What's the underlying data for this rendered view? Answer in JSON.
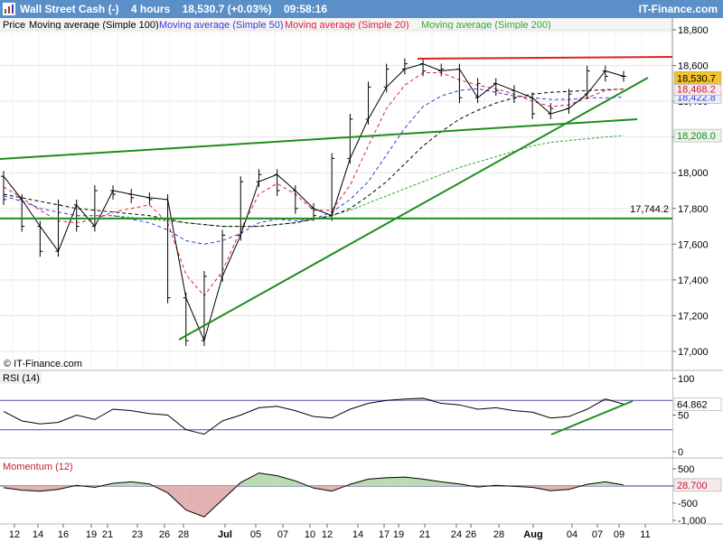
{
  "header": {
    "title": "Wall Street Cash (-)    4 hours    18,530.7 (+0.03%)    09:58:16",
    "brand": "IT-Finance.com"
  },
  "legend": {
    "price": "Price",
    "ma100": "Moving average (Simple 100)",
    "ma50": "Moving average (Simple 50)",
    "ma20": "Moving average (Simple 20)",
    "ma200": "Moving average (Simple 200)"
  },
  "colors": {
    "ma100": "#000000",
    "ma50": "#3a3ad8",
    "ma20": "#e0203c",
    "ma200": "#32a832",
    "trend": "#1e8c1e",
    "resistance": "#e02020",
    "price_tag": "#f2c22c"
  },
  "watermark": "© IT-Finance.com",
  "chart_data": [
    {
      "type": "line",
      "panel": "price",
      "ylim": [
        16900,
        18900
      ],
      "y_ticks": [
        "18,800",
        "18,600",
        "18,400",
        "18,200",
        "18,000",
        "17,800",
        "17,600",
        "17,400",
        "17,200",
        "17,000"
      ],
      "x_ticks": [
        "12",
        "14",
        "16",
        "19",
        "21",
        "23",
        "26",
        "28",
        "Jul",
        "05",
        "07",
        "10",
        "12",
        "14",
        "17",
        "19",
        "21",
        "24",
        "26",
        "28",
        "Aug",
        "04",
        "07",
        "09",
        "11"
      ],
      "series": [
        {
          "name": "Price",
          "values": [
            17980,
            17850,
            17700,
            17560,
            17820,
            17700,
            17900,
            17880,
            17860,
            17850,
            17300,
            17060,
            17420,
            17650,
            17950,
            17990,
            17900,
            17800,
            17760,
            18080,
            18300,
            18480,
            18580,
            18610,
            18570,
            18580,
            18420,
            18500,
            18460,
            18420,
            18330,
            18360,
            18440,
            18570,
            18540
          ]
        },
        {
          "name": "Moving average (Simple 20)",
          "values": [
            17920,
            17860,
            17790,
            17730,
            17720,
            17740,
            17780,
            17800,
            17820,
            17720,
            17430,
            17310,
            17450,
            17680,
            17880,
            17940,
            17880,
            17790,
            17790,
            17930,
            18150,
            18360,
            18490,
            18560,
            18560,
            18520,
            18490,
            18470,
            18440,
            18400,
            18370,
            18380,
            18420,
            18460,
            18470
          ]
        },
        {
          "name": "Moving average (Simple 50)",
          "values": [
            17870,
            17840,
            17800,
            17780,
            17760,
            17760,
            17760,
            17740,
            17720,
            17680,
            17620,
            17600,
            17620,
            17660,
            17720,
            17740,
            17730,
            17740,
            17780,
            17850,
            17950,
            18100,
            18250,
            18370,
            18430,
            18460,
            18470,
            18450,
            18430,
            18420,
            18410,
            18410,
            18420,
            18420,
            18423
          ]
        },
        {
          "name": "Moving average (Simple 100)",
          "values": [
            17880,
            17860,
            17840,
            17820,
            17800,
            17790,
            17780,
            17770,
            17760,
            17740,
            17720,
            17710,
            17700,
            17700,
            17700,
            17710,
            17720,
            17740,
            17760,
            17800,
            17870,
            17950,
            18050,
            18150,
            18230,
            18300,
            18350,
            18390,
            18420,
            18440,
            18450,
            18455,
            18460,
            18465,
            18468
          ]
        },
        {
          "name": "Moving average (Simple 200)",
          "values": [
            null,
            null,
            null,
            null,
            null,
            null,
            17760,
            17750,
            17740,
            17730,
            17720,
            17710,
            17700,
            17700,
            17700,
            17710,
            17720,
            17740,
            17760,
            17790,
            17830,
            17870,
            17910,
            17950,
            17990,
            18030,
            18060,
            18090,
            18120,
            18150,
            18170,
            18180,
            18190,
            18200,
            18208
          ]
        }
      ],
      "labels": {
        "ma200_value": "18,208.0",
        "ma50_value": "18,422.8",
        "ma100_value": "18,468.2",
        "price_value": "18,530.7",
        "support_value": "17,744.2"
      }
    },
    {
      "type": "line",
      "panel": "rsi",
      "title": "RSI (14)",
      "ylim": [
        0,
        100
      ],
      "y_ticks": [
        "100",
        "50",
        "0"
      ],
      "levels": [
        70,
        30
      ],
      "series": [
        {
          "name": "RSI (14)",
          "values": [
            55,
            42,
            38,
            40,
            50,
            44,
            58,
            56,
            52,
            50,
            30,
            24,
            42,
            50,
            60,
            62,
            56,
            48,
            46,
            58,
            66,
            70,
            72,
            73,
            66,
            64,
            58,
            60,
            56,
            54,
            46,
            48,
            58,
            72,
            65
          ]
        }
      ],
      "labels": {
        "value": "64.862"
      }
    },
    {
      "type": "area",
      "panel": "momentum",
      "title": "Momentum (12)",
      "ylim": [
        -1100,
        600
      ],
      "y_ticks": [
        "500",
        "0",
        "-500",
        "-1,000"
      ],
      "series": [
        {
          "name": "Momentum (12)",
          "values": [
            -50,
            -120,
            -150,
            -100,
            20,
            -40,
            80,
            120,
            60,
            -200,
            -700,
            -900,
            -400,
            100,
            380,
            300,
            150,
            -60,
            -150,
            50,
            200,
            240,
            260,
            200,
            120,
            60,
            -30,
            20,
            -10,
            -40,
            -140,
            -100,
            50,
            120,
            28.7
          ]
        }
      ],
      "labels": {
        "value": "28.700"
      }
    }
  ]
}
